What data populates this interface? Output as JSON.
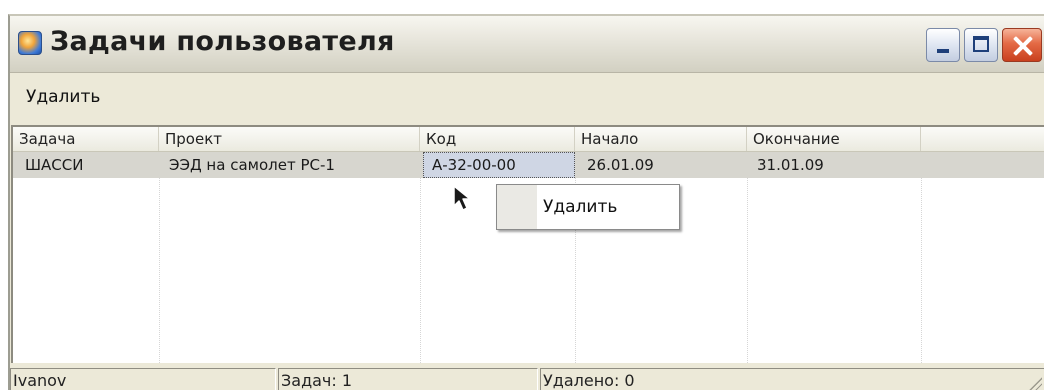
{
  "window": {
    "title": "Задачи пользователя",
    "icon": "app-globe-icon",
    "controls": [
      "minimize-icon",
      "maximize-icon",
      "close-icon"
    ]
  },
  "toolbar": {
    "delete_label": "Удалить"
  },
  "grid": {
    "columns": [
      "Задача",
      "Проект",
      "Код",
      "Начало",
      "Окончание"
    ],
    "rows": [
      {
        "task": "ШАССИ",
        "project": "ЭЭД на самолет РС-1",
        "code": "А-32-00-00",
        "start": "26.01.09",
        "end": "31.01.09"
      }
    ]
  },
  "context_menu": {
    "items": [
      "Удалить"
    ]
  },
  "statusbar": {
    "user": "Ivanov",
    "tasks": "Задач: 1",
    "deleted": "Удалено: 0"
  },
  "colors": {
    "window_bg": "#ece9d8",
    "selected_row": "#d7d6cf",
    "close_button": "#e46a45"
  }
}
